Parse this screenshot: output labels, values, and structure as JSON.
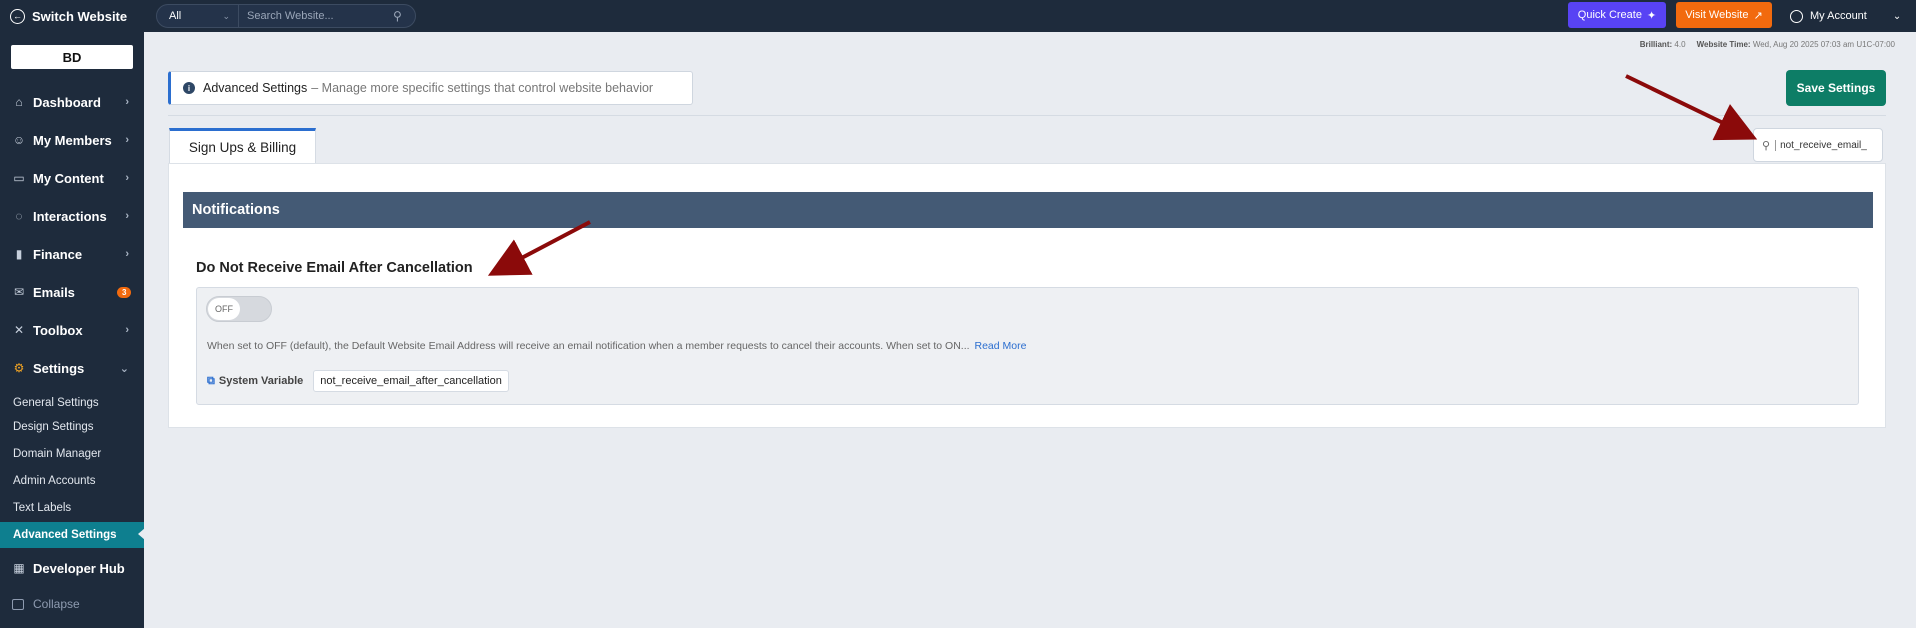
{
  "topbar": {
    "switch_label": "Switch Website",
    "search_scope": "All",
    "search_placeholder": "Search Website...",
    "quick_create": "Quick Create",
    "visit_website": "Visit Website",
    "my_account": "My Account"
  },
  "sidebar": {
    "logo_text": "BD",
    "items": [
      {
        "label": "Dashboard",
        "icon": "home-icon"
      },
      {
        "label": "My Members",
        "icon": "users-icon"
      },
      {
        "label": "My Content",
        "icon": "content-icon"
      },
      {
        "label": "Interactions",
        "icon": "chat-icon"
      },
      {
        "label": "Finance",
        "icon": "chart-icon"
      },
      {
        "label": "Emails",
        "icon": "mail-icon",
        "badge": "3"
      },
      {
        "label": "Toolbox",
        "icon": "tools-icon"
      },
      {
        "label": "Settings",
        "icon": "gear-icon"
      }
    ],
    "sub_items": [
      "General Settings",
      "Design Settings",
      "Domain Manager",
      "Admin Accounts",
      "Text Labels",
      "Advanced Settings"
    ],
    "developer_hub": "Developer Hub",
    "collapse": "Collapse"
  },
  "meta": {
    "brilliant_label": "Brilliant:",
    "brilliant_value": "4.0",
    "time_label": "Website Time:",
    "time_value": "Wed, Aug 20 2025 07:03 am U1C-07:00"
  },
  "banner": {
    "title": "Advanced Settings",
    "desc": "– Manage more specific settings that control website behavior"
  },
  "save_label": "Save Settings",
  "tab_label": "Sign Ups & Billing",
  "tab_search_value": "not_receive_email_",
  "section_title": "Notifications",
  "setting": {
    "title": "Do Not Receive Email After Cancellation",
    "toggle_state": "OFF",
    "help": "When set to OFF (default), the Default Website Email Address will receive an email notification when a member requests to cancel their accounts.  When set to ON...",
    "read_more": "Read More",
    "sysvar_label": "System Variable",
    "sysvar_value": "not_receive_email_after_cancellation"
  },
  "colors": {
    "sidebar_bg": "#1e2b3c",
    "accent_blue": "#2b6ecf",
    "save_green": "#0d7d66",
    "quick_purple": "#5843f4",
    "visit_orange": "#f26a0e",
    "active_teal": "#0e7f8f",
    "section_header": "#445a75",
    "annotation_arrow": "#8b0a0a"
  }
}
